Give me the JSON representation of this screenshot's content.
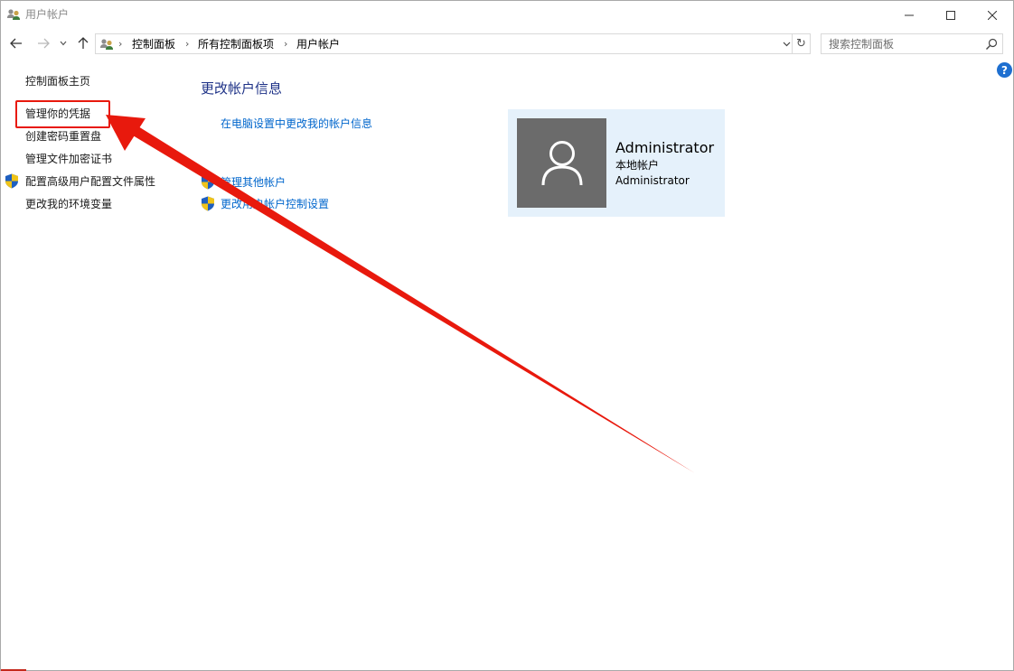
{
  "window": {
    "title": "用户帐户"
  },
  "controls": {
    "minimize": "minimize",
    "maximize": "maximize",
    "close": "close"
  },
  "address": {
    "crumbs": [
      "控制面板",
      "所有控制面板项",
      "用户帐户"
    ]
  },
  "search": {
    "placeholder": "搜索控制面板"
  },
  "help": {
    "label": "?"
  },
  "sidebar": {
    "items": [
      {
        "label": "控制面板主页"
      },
      {
        "label": "管理你的凭据"
      },
      {
        "label": "创建密码重置盘"
      },
      {
        "label": "管理文件加密证书"
      },
      {
        "label": "配置高级用户配置文件属性"
      },
      {
        "label": "更改我的环境变量"
      }
    ]
  },
  "main": {
    "title": "更改帐户信息",
    "links": {
      "pc_settings": "在电脑设置中更改我的帐户信息",
      "manage_other": "管理其他帐户",
      "uac": "更改用户帐户控制设置"
    }
  },
  "account": {
    "name": "Administrator",
    "type": "本地帐户",
    "group": "Administrator"
  },
  "colors": {
    "accent": "#1e3287",
    "link": "#0066cc",
    "annotation": "#e8190d",
    "card_bg": "#e5f1fb",
    "avatar_bg": "#6b6b6b"
  }
}
